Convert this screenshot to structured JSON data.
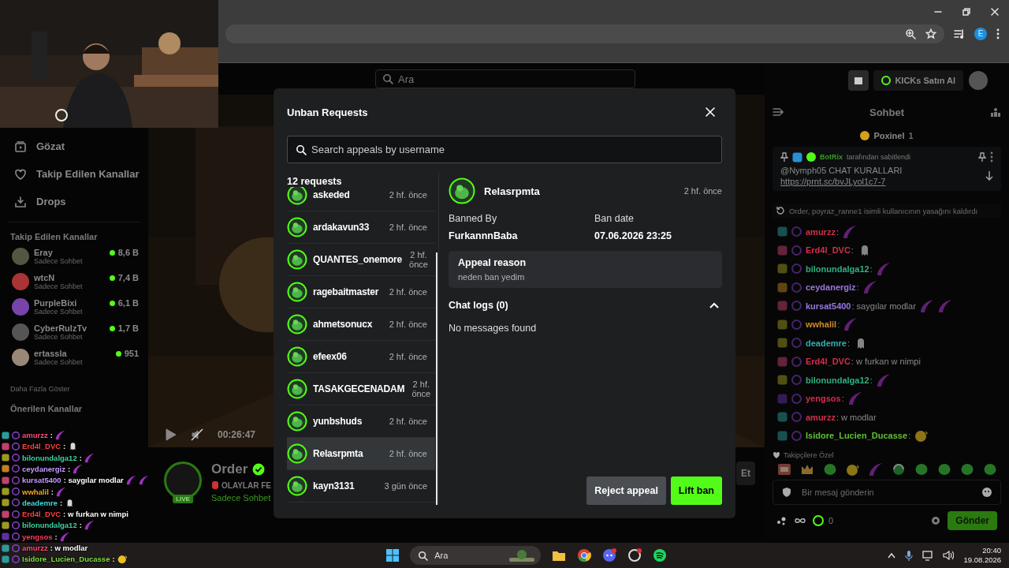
{
  "browser": {
    "profile_initial": "E"
  },
  "sidebar": {
    "nav": [
      {
        "label": "Gözat",
        "kind": "browse"
      },
      {
        "label": "Takip Edilen Kanallar",
        "kind": "heart"
      },
      {
        "label": "Drops",
        "kind": "drops"
      }
    ],
    "followed_title": "Takip Edilen Kanallar",
    "followed": [
      {
        "name": "Eray",
        "status": "Sadece Sohbet",
        "viewers": "8,6 B"
      },
      {
        "name": "wtcN",
        "status": "Sadece Sohbet",
        "viewers": "7,4 B"
      },
      {
        "name": "PurpleBixi",
        "status": "Sadece Sohbet",
        "viewers": "6,1 B"
      },
      {
        "name": "CyberRulzTv",
        "status": "Sadece Sohbet",
        "viewers": "1,7 B"
      },
      {
        "name": "ertassla",
        "status": "Sadece Sohbet",
        "viewers": "951"
      }
    ],
    "show_more": "Daha Fazla Göster",
    "recommended_title": "Önerilen Kanallar"
  },
  "page_header": {
    "search_placeholder": "Ara",
    "kicks_button": "KICKs Satın Al"
  },
  "player": {
    "time": "00:26:47"
  },
  "channel": {
    "name": "Order",
    "title": "OLAYLAR FE",
    "status": "Sadece Sohbet",
    "live_badge": "LIVE",
    "follow_button": "Et"
  },
  "chat": {
    "title": "Sohbet",
    "top_gifter": {
      "name": "Poxinel",
      "count": "1"
    },
    "pinned": {
      "author": "BotRix",
      "suffix": "tarafından sabitlendi",
      "text": "@Nymph05 CHAT KURALLARI",
      "link": "https://prnt.sc/bvJLyol1c7-7"
    },
    "system": "Order, poyraz_ranne1 isimli kullanıcının yasağını kaldırdı",
    "messages": [
      {
        "user": "amurzz",
        "color": "#d0304a",
        "text": ":",
        "emotes": [
          {
            "kind": "feather"
          }
        ]
      },
      {
        "user": "Erd4l_DVC",
        "color": "#d0304a",
        "text": ":",
        "emotes": [
          {
            "kind": "ghost"
          }
        ]
      },
      {
        "user": "bilonundalga12",
        "color": "#2fb080",
        "text": ":",
        "emotes": [
          {
            "kind": "feather"
          }
        ]
      },
      {
        "user": "ceydanergiz",
        "color": "#9a78e0",
        "text": ":",
        "emotes": [
          {
            "kind": "feather"
          }
        ]
      },
      {
        "user": "kursat5400",
        "color": "#9a78e0",
        "text": ": saygılar modlar",
        "emotes": [
          {
            "kind": "feather"
          },
          {
            "kind": "feather"
          }
        ]
      },
      {
        "user": "wwhalil",
        "color": "#d08a28",
        "text": ":",
        "emotes": [
          {
            "kind": "feather"
          }
        ]
      },
      {
        "user": "deademre",
        "color": "#30b0b0",
        "text": ":",
        "emotes": [
          {
            "kind": "ghost"
          }
        ]
      },
      {
        "user": "Erd4l_DVC",
        "color": "#d0304a",
        "text": ": w furkan w nimpi"
      },
      {
        "user": "bilonundalga12",
        "color": "#2fb080",
        "text": ":",
        "emotes": [
          {
            "kind": "feather"
          }
        ]
      },
      {
        "user": "yengsos",
        "color": "#d0304a",
        "text": ":",
        "emotes": [
          {
            "kind": "feather"
          }
        ]
      },
      {
        "user": "amurzz",
        "color": "#d0304a",
        "text": ": w modlar"
      },
      {
        "user": "Isidore_Lucien_Ducasse",
        "color": "#60c030",
        "text": ":",
        "emotes": [
          {
            "kind": "face"
          }
        ]
      }
    ],
    "emote_section": "Takipçilere Özel",
    "emote_bar": [
      {
        "kind": "meme"
      },
      {
        "kind": "crown"
      },
      {
        "kind": "blob"
      },
      {
        "kind": "face"
      },
      {
        "kind": "feather"
      },
      {
        "kind": "headset"
      },
      {
        "kind": "blob"
      },
      {
        "kind": "blob"
      },
      {
        "kind": "blob"
      },
      {
        "kind": "blob"
      }
    ],
    "input_placeholder": "Bir mesaj gönderin",
    "points": "0",
    "send_button": "Gönder"
  },
  "overlay_chat": [
    {
      "user": "amurzz",
      "color": "#ff4d7a",
      "text": ":",
      "emotes": [
        {
          "kind": "feather"
        }
      ]
    },
    {
      "user": "Erd4l_DVC",
      "color": "#ff4040",
      "text": ":",
      "emotes": [
        {
          "kind": "ghost"
        }
      ]
    },
    {
      "user": "bilonundalga12",
      "color": "#3ed3a0",
      "text": ":",
      "emotes": [
        {
          "kind": "feather"
        }
      ]
    },
    {
      "user": "ceydanergiz",
      "color": "#c49cff",
      "text": ":",
      "emotes": [
        {
          "kind": "feather"
        }
      ]
    },
    {
      "user": "kursat5400",
      "color": "#c49cff",
      "text": ": saygılar modlar",
      "emotes": [
        {
          "kind": "feather"
        },
        {
          "kind": "feather"
        }
      ]
    },
    {
      "user": "wwhalil",
      "color": "#f5a623",
      "text": ":",
      "emotes": [
        {
          "kind": "feather"
        }
      ]
    },
    {
      "user": "deademre",
      "color": "#3fd8d8",
      "text": ":",
      "emotes": [
        {
          "kind": "ghost"
        }
      ]
    },
    {
      "user": "Erd4l_DVC",
      "color": "#ff4040",
      "text": ": w furkan w nimpi"
    },
    {
      "user": "bilonundalga12",
      "color": "#3ed3a0",
      "text": ":",
      "emotes": [
        {
          "kind": "feather"
        }
      ]
    },
    {
      "user": "yengsos",
      "color": "#ff3b5b",
      "text": ":",
      "emotes": [
        {
          "kind": "feather"
        }
      ]
    },
    {
      "user": "amurzz",
      "color": "#ff4d7a",
      "text": ": w modlar"
    },
    {
      "user": "Isidore_Lucien_Ducasse",
      "color": "#7ee040",
      "text": ":",
      "emotes": [
        {
          "kind": "face"
        }
      ]
    }
  ],
  "modal": {
    "title": "Unban Requests",
    "search_placeholder": "Search appeals by username",
    "count": "12 requests",
    "requests": [
      {
        "name": "askeded",
        "time": "2 hf. önce",
        "selected": false
      },
      {
        "name": "ardakavun33",
        "time": "2 hf. önce",
        "selected": false
      },
      {
        "name": "QUANTES_onemore",
        "time": "2 hf. önce",
        "selected": false
      },
      {
        "name": "ragebaitmaster",
        "time": "2 hf. önce",
        "selected": false
      },
      {
        "name": "ahmetsonucx",
        "time": "2 hf. önce",
        "selected": false
      },
      {
        "name": "efeex06",
        "time": "2 hf. önce",
        "selected": false
      },
      {
        "name": "TASAKGECENADAM",
        "time": "2 hf. önce",
        "selected": false
      },
      {
        "name": "yunbshuds",
        "time": "2 hf. önce",
        "selected": false
      },
      {
        "name": "Relasrpmta",
        "time": "2 hf. önce",
        "selected": true
      },
      {
        "name": "kayn3131",
        "time": "3 gün önce",
        "selected": false
      }
    ],
    "detail": {
      "name": "Relasrpmta",
      "time": "2 hf. önce",
      "banned_by_label": "Banned By",
      "banned_by": "FurkannnBaba",
      "ban_date_label": "Ban date",
      "ban_date": "07.06.2026 23:25",
      "reason_label": "Appeal reason",
      "reason": "neden ban yedim",
      "chat_logs": {
        "label": "Chat logs (0)",
        "expanded": true,
        "empty": "No messages found"
      }
    },
    "buttons": [
      {
        "label": "Reject appeal",
        "kind": "secondary"
      },
      {
        "label": "Lift ban",
        "kind": "primary"
      }
    ]
  },
  "taskbar": {
    "search": "Ara",
    "time": "20:40",
    "date": "19.08.2026"
  }
}
